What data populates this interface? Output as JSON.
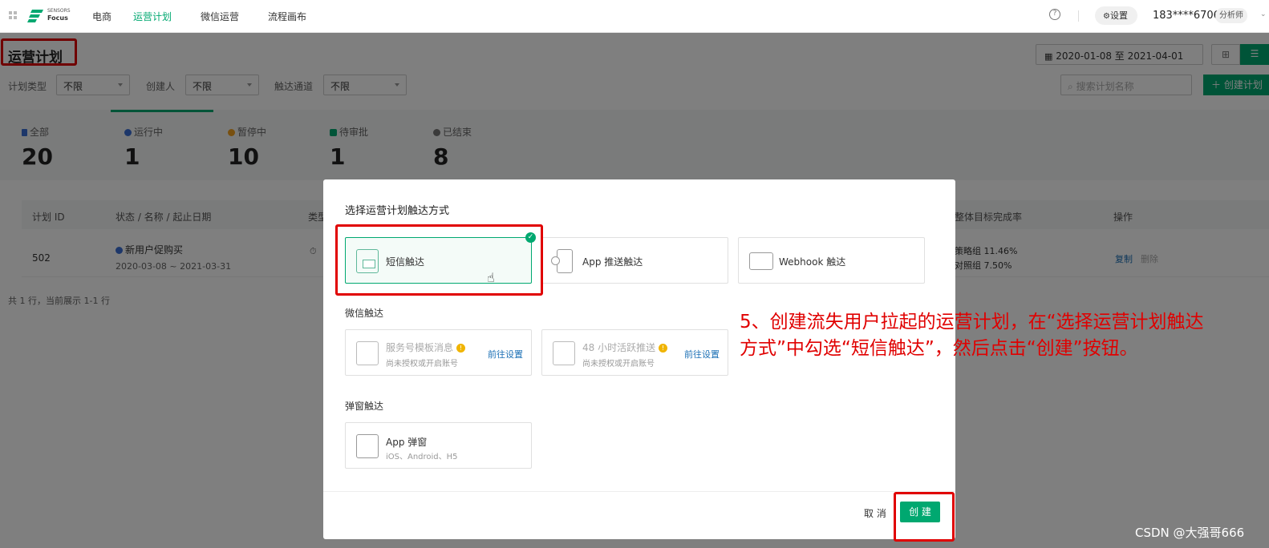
{
  "topbar": {
    "logo_line1": "SENSORS",
    "logo_line2": "Focus",
    "nav": [
      "电商",
      "运营计划",
      "微信运营",
      "流程画布"
    ],
    "settings_label": "设置",
    "user": "183****6706",
    "role": "分析师"
  },
  "page": {
    "title": "运营计划",
    "date_range": "2020-01-08 至 2021-04-01",
    "filters": [
      {
        "label": "计划类型",
        "value": "不限"
      },
      {
        "label": "创建人",
        "value": "不限"
      },
      {
        "label": "触达通道",
        "value": "不限"
      }
    ],
    "search_placeholder": "搜索计划名称",
    "create_plan_label": "创建计划",
    "stats": [
      {
        "label": "全部",
        "value": "20"
      },
      {
        "label": "运行中",
        "value": "1"
      },
      {
        "label": "暂停中",
        "value": "10"
      },
      {
        "label": "待审批",
        "value": "1"
      },
      {
        "label": "已结束",
        "value": "8"
      }
    ],
    "table_headers": {
      "id": "计划 ID",
      "status": "状态 / 名称 / 起止日期",
      "type": "类型",
      "rate": "整体目标完成率",
      "ops": "操作"
    },
    "row": {
      "id": "502",
      "name": "新用户促购买",
      "dates": "2020-03-08 ~ 2021-03-31",
      "rate1": "策略组 11.46%",
      "rate2": "对照组 7.50%",
      "copy": "复制",
      "delete": "删除"
    },
    "footer": "共 1 行，当前展示 1-1 行"
  },
  "modal": {
    "title": "选择运营计划触达方式",
    "sms": "短信触达",
    "app_push": "App 推送触达",
    "webhook": "Webhook 触达",
    "wechat_section": "微信触达",
    "wechat_template": "服务号模板消息",
    "wechat_template_sub": "尚未授权或开启账号",
    "wechat_48h": "48 小时活跃推送",
    "wechat_48h_sub": "尚未授权或开启账号",
    "goto_settings": "前往设置",
    "popup_section": "弹窗触达",
    "app_popup": "App 弹窗",
    "app_popup_sub": "iOS、Android、H5",
    "cancel": "取 消",
    "create": "创 建"
  },
  "annotation": {
    "line1": "5、创建流失用户拉起的运营计划，在“选择运营计划触达",
    "line2": "方式”中勾选“短信触达”，然后点击“创建”按钮。"
  },
  "watermark": "CSDN @大强哥666",
  "colors": {
    "brand": "#00a870",
    "annotation": "#e00000",
    "link": "#1a6fb5"
  }
}
